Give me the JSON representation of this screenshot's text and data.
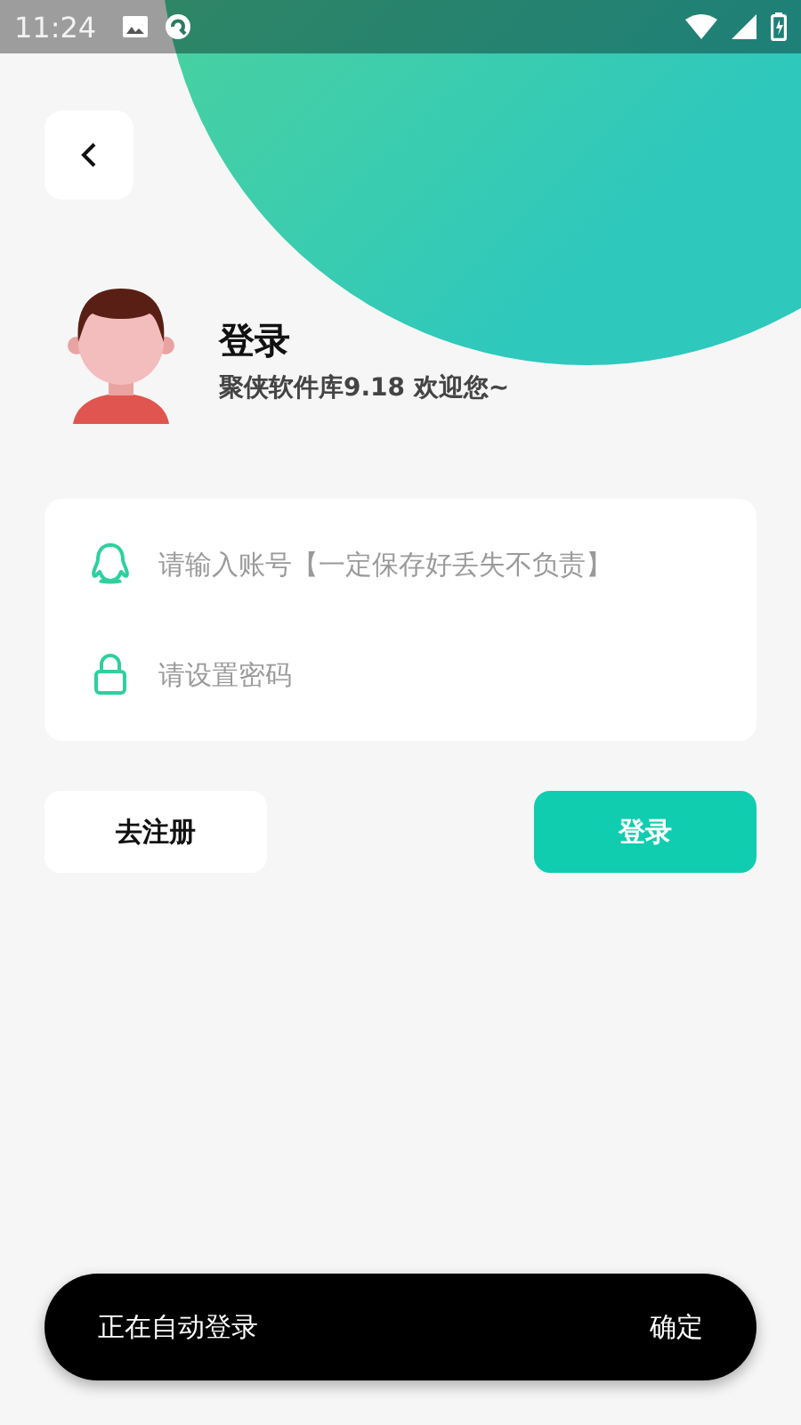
{
  "status_bar": {
    "time": "11:24"
  },
  "header": {
    "title": "登录",
    "subtitle": "聚侠软件库9.18 欢迎您~"
  },
  "form": {
    "fields": [
      {
        "kind": "account",
        "placeholder": "请输入账号【一定保存好丢失不负责】"
      },
      {
        "kind": "password",
        "placeholder": "请设置密码"
      }
    ]
  },
  "buttons": {
    "register": "去注册",
    "login": "登录"
  },
  "toast": {
    "message": "正在自动登录",
    "action": "确定"
  }
}
